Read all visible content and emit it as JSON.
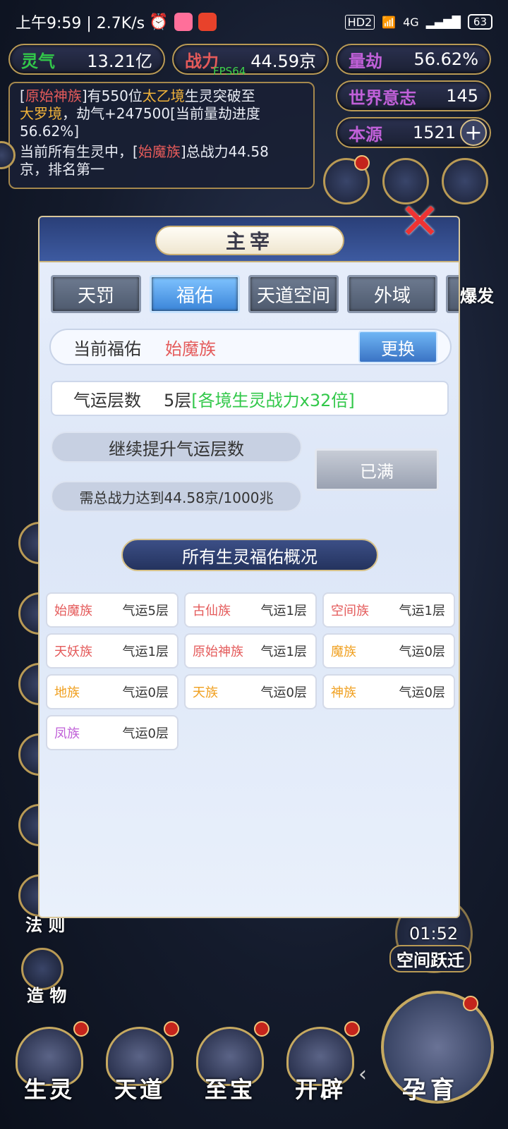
{
  "status_bar": {
    "time_speed": "上午9:59 | 2.7K/s",
    "network": "HD2",
    "signal": "4G",
    "battery": "63"
  },
  "fps": "FPS64",
  "resources": {
    "lingqi": {
      "label": "灵气",
      "value": "13.21亿"
    },
    "zhanli": {
      "label": "战力",
      "value": "44.59京"
    },
    "liangjie": {
      "label": "量劫",
      "value": "56.62%"
    },
    "shijie": {
      "label": "世界意志",
      "value": "145"
    },
    "benyuan": {
      "label": "本源",
      "value": "1521"
    }
  },
  "message": {
    "l1_br1": "[",
    "l1_race": "原始神族",
    "l1_br2": "]有550位",
    "l1_realm": "太乙境",
    "l1_t1": "生灵突破至",
    "l2_realm": "大罗境",
    "l2_t1": "，劫气+247500[当前量劫进度",
    "l3": "56.62%]",
    "l4_t1": "当前所有生灵中，[",
    "l4_race": "始魔族",
    "l4_t2": "]总战力44.58",
    "l5": "京，排名第一"
  },
  "side_left": [
    "法 则",
    "造 物"
  ],
  "side_right": {
    "timer": "01:52",
    "label": "空间跃迁",
    "peek_btn": "爆发"
  },
  "nav": [
    "生灵",
    "天道",
    "至宝",
    "开辟",
    "孕育"
  ],
  "dialog": {
    "title": "主宰",
    "tabs": [
      "天罚",
      "福佑",
      "天道空间",
      "外域"
    ],
    "current_label": "当前福佑",
    "current_value": "始魔族",
    "change_button": "更换",
    "luck_label": "气运层数",
    "luck_value": "5层",
    "luck_bonus": "[各境生灵战力x32倍]",
    "upgrade_label": "继续提升气运层数",
    "requirement": "需总战力达到44.58京/1000兆",
    "full_button": "已满",
    "overview_title": "所有生灵福佑概况",
    "races": [
      {
        "name": "始魔族",
        "luck": "气运5层",
        "color": "#e45a5a"
      },
      {
        "name": "古仙族",
        "luck": "气运1层",
        "color": "#e45a5a"
      },
      {
        "name": "空间族",
        "luck": "气运1层",
        "color": "#e45a5a"
      },
      {
        "name": "天妖族",
        "luck": "气运1层",
        "color": "#e45a5a"
      },
      {
        "name": "原始神族",
        "luck": "气运1层",
        "color": "#e45a5a"
      },
      {
        "name": "魔族",
        "luck": "气运0层",
        "color": "#f0a020"
      },
      {
        "name": "地族",
        "luck": "气运0层",
        "color": "#f0a020"
      },
      {
        "name": "天族",
        "luck": "气运0层",
        "color": "#f0a020"
      },
      {
        "name": "神族",
        "luck": "气运0层",
        "color": "#f0a020"
      },
      {
        "name": "凤族",
        "luck": "气运0层",
        "color": "#c060d8"
      }
    ]
  }
}
